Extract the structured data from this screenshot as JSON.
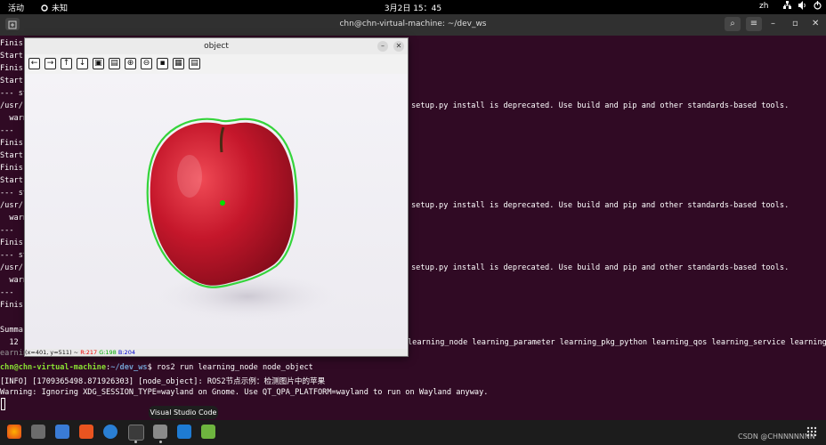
{
  "topbar": {
    "activities": "活动",
    "app_name": "未知",
    "clock": "3月2日 15：45",
    "lang": "zh"
  },
  "terminal_window": {
    "title": "chn@chn-virtual-machine: ~/dev_ws"
  },
  "terminal": {
    "lines": [
      "Finis",
      "Start",
      "Finis",
      "Start",
      "--- st",
      "/usr/",
      "  warn",
      "---",
      "Finis",
      "Start",
      "Finis",
      "Start",
      "--- st",
      "/usr/",
      "  warn",
      "---",
      "Finis",
      "--- st",
      "/usr/",
      "  warn",
      "---",
      "Finis",
      "Summa",
      "  12 ("
    ],
    "right_lines": {
      "l1": "setup.py install is deprecated. Use build and pip and other standards-based tools.",
      "l2": "setup.py install is deprecated. Use build and pip and other standards-based tools.",
      "l3": "setup.py install is deprecated. Use build and pip and other standards-based tools.",
      "summary_tail": "learning_node learning_parameter learning_pkg_python learning_qos learning_service learning_tf l",
      "summary_wrap": "earning_topic learning_urdf"
    },
    "prompt_user": "chn@chn-virtual-machine",
    "prompt_sep": ":",
    "prompt_path": "~/dev_ws",
    "command": "$ ros2 run learning_node node_object",
    "info_line": "[INFO] [1709365498.871926303] [node_object]: ROS2节点示例：检测图片中的苹果",
    "warning_line": "Warning: Ignoring XDG_SESSION_TYPE=wayland on Gnome. Use QT_QPA_PLATFORM=wayland to run on Wayland anyway."
  },
  "cv_window": {
    "title": "object",
    "status": {
      "coords": "(x=401, y=511) ~ ",
      "r": "R:217",
      "g": "G:198",
      "b": "B:204"
    },
    "toolbar_icons": [
      "arrow-left-icon",
      "arrow-right-icon",
      "arrow-up-icon",
      "arrow-down-icon",
      "zoom-fit-icon",
      "zoom-original-icon",
      "zoom-in-icon",
      "zoom-out-icon",
      "save-icon",
      "copy-icon",
      "properties-icon"
    ]
  },
  "dock": {
    "tooltip": "Visual Studio Code",
    "watermark": "CSDN @CHNNNNNNN"
  },
  "colors": {
    "terminal_bg": "#300a24",
    "contour": "#35d43b",
    "centroid": "#00e000"
  }
}
